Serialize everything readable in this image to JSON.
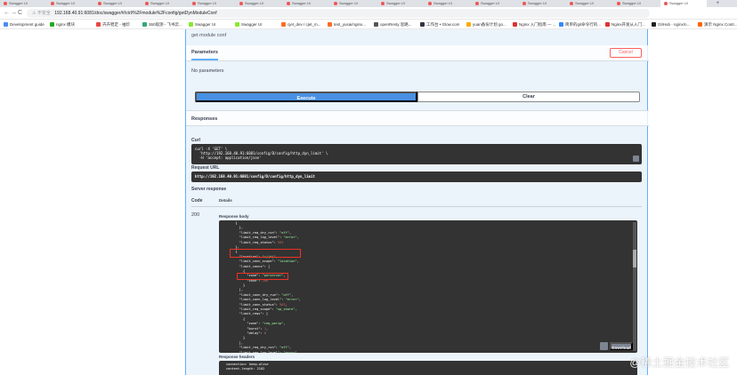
{
  "browser": {
    "tabs": [
      "Swagger UI",
      "Swagger UI",
      "Swagger UI",
      "Swagger UI",
      "Swagger UI",
      "Swagger UI",
      "Swagger UI",
      "Swagger UI",
      "Swagger UI",
      "Swagger UI",
      "Swagger UI",
      "Swagger UI",
      "Swagger UI",
      "Swagger UI",
      "Swagger UI"
    ],
    "new_tab": "+",
    "back": "←",
    "forward": "→",
    "reload": "C",
    "security_warning": "⚠ 不安全",
    "url": "192.168.40.91:6081/doc/swagger/#/ctrl/%2Fmodule%2Fconfig/getDynModuleConf"
  },
  "bookmarks": [
    {
      "label": "Development guide",
      "color": "#4a8cf0"
    },
    {
      "label": "nginx 模块",
      "color": "#2a2"
    },
    {
      "label": "卉卉稳定 - 袖珍",
      "color": "#e44"
    },
    {
      "label": "360观测 - 飞书云...",
      "color": "#3a7"
    },
    {
      "label": "Swagger UI",
      "color": "#85ea2d"
    },
    {
      "label": "Swagger UI",
      "color": "#85ea2d"
    },
    {
      "label": "cjet_dev / cjet_m...",
      "color": "#fc6d26"
    },
    {
      "label": "test_yusai/nginx...",
      "color": "#fc6d26"
    },
    {
      "label": "openResty 思路...",
      "color": "#555"
    },
    {
      "label": "工作台 • Glow.com",
      "color": "#334"
    },
    {
      "label": "yuan备份计划 go...",
      "color": "#fa0"
    },
    {
      "label": "Nginx 入门指南 — ...",
      "color": "#d33"
    },
    {
      "label": "简单的git命令行的...",
      "color": "#38f"
    },
    {
      "label": "Nginx开发从入门...",
      "color": "#d33"
    },
    {
      "label": "GitHub - nginx/n...",
      "color": "#222"
    },
    {
      "label": "演示 Nginx Contr...",
      "color": "#f60"
    }
  ],
  "operation": {
    "description": "get module conf",
    "parameters_title": "Parameters",
    "cancel_label": "Cancel",
    "no_parameters": "No parameters",
    "execute_label": "Execute",
    "clear_label": "Clear",
    "responses_title": "Responses",
    "curl_label": "Curl",
    "curl_lines": [
      "curl -X 'GET' \\",
      "  'http://192.168.40.91:6081/config/D/config/http_dyn_limit' \\",
      "  -H 'accept: application/json'"
    ],
    "request_url_label": "Request URL",
    "request_url": "http://192.168.40.91:6081/config/D/config/http_dyn_limit",
    "server_response_label": "Server response",
    "code_col": "Code",
    "details_col": "Details",
    "code_value": "200",
    "response_body_label": "Response body",
    "response_body_lines": [
      "  {",
      "    },",
      "    \"limit_req_dry_run\": \"off\",",
      "    \"limit_req_log_level\": \"error\",",
      "    \"limit_req_status\": 503",
      "  },",
      "  {",
      "    \"location\": \"~/(d)\",",
      "    \"limit_conn_scope\": \"location\",",
      "    \"limit_conns\": [",
      "      {",
      "        \"zone\": \"perserver\",",
      "        \"conn\": 200",
      "      }",
      "    ],",
      "    \"limit_conn_dry_run\": \"off\",",
      "    \"limit_conn_log_level\": \"error\",",
      "    \"limit_conn_status\": 503,",
      "    \"limit_req_scope\": \"up_share\",",
      "    \"limit_reqs\": [",
      "      {",
      "        \"zone\": \"req_perip\",",
      "        \"burst\": 1,",
      "        \"delay\": 0",
      "      }",
      "    ],",
      "    \"limit_req_dry_run\": \"off\",",
      "    \"limit_req_log_level\": \"error\",",
      "    \"limit_req_status\": 503"
    ],
    "download_label": "Download",
    "response_headers_label": "Response headers",
    "response_headers_lines": [
      "connection: keep-alive",
      "content-length: 2102"
    ]
  },
  "watermark": "@稀土掘金技术社区"
}
